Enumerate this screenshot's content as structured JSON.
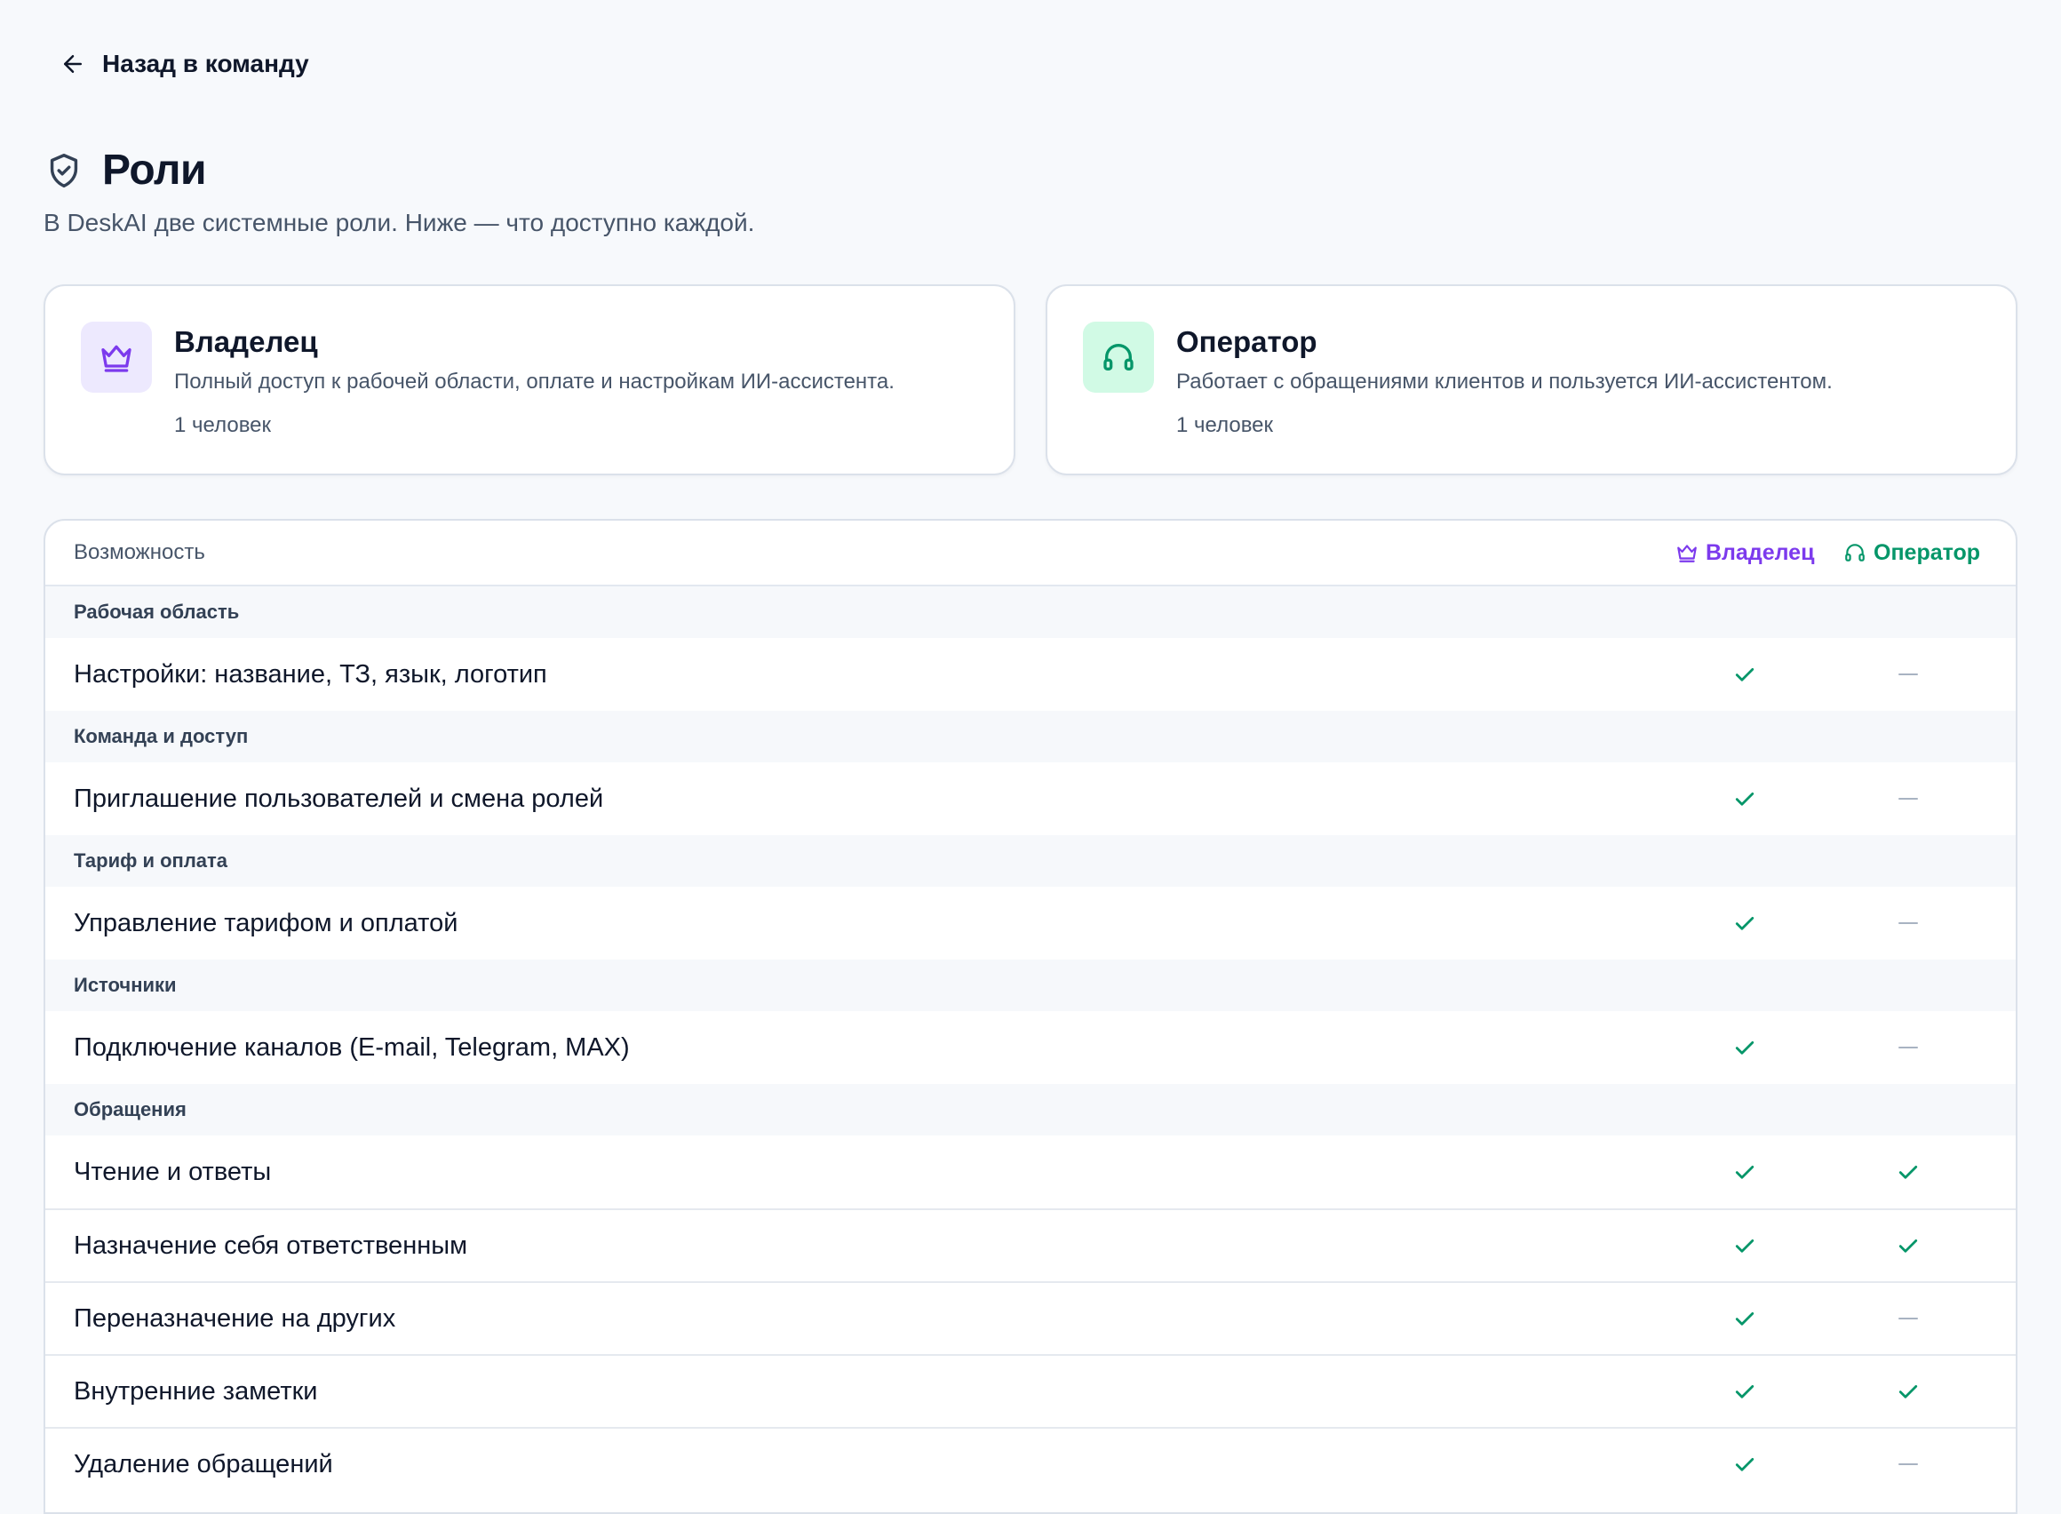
{
  "nav": {
    "back_label": "Назад в команду"
  },
  "header": {
    "title": "Роли",
    "subtitle": "В DeskAI две системные роли. Ниже — что доступно каждой."
  },
  "roles": [
    {
      "name": "Владелец",
      "description": "Полный доступ к рабочей области, оплате и настройкам ИИ-ассистента.",
      "count": "1 человек",
      "icon": "crown-icon",
      "color": "#7c3aed"
    },
    {
      "name": "Оператор",
      "description": "Работает с обращениями клиентов и пользуется ИИ-ассистентом.",
      "count": "1 человек",
      "icon": "headset-icon",
      "color": "#059669"
    }
  ],
  "table": {
    "capability_header": "Возможность",
    "owner_header": "Владелец",
    "operator_header": "Оператор",
    "sections": [
      {
        "title": "Рабочая область",
        "rows": [
          {
            "label": "Настройки: название, ТЗ, язык, логотип",
            "owner": true,
            "operator": false
          }
        ]
      },
      {
        "title": "Команда и доступ",
        "rows": [
          {
            "label": "Приглашение пользователей и смена ролей",
            "owner": true,
            "operator": false
          }
        ]
      },
      {
        "title": "Тариф и оплата",
        "rows": [
          {
            "label": "Управление тарифом и оплатой",
            "owner": true,
            "operator": false
          }
        ]
      },
      {
        "title": "Источники",
        "rows": [
          {
            "label": "Подключение каналов (E-mail, Telegram, MAX)",
            "owner": true,
            "operator": false
          }
        ]
      },
      {
        "title": "Обращения",
        "rows": [
          {
            "label": "Чтение и ответы",
            "owner": true,
            "operator": true
          },
          {
            "label": "Назначение себя ответственным",
            "owner": true,
            "operator": true
          },
          {
            "label": "Переназначение на других",
            "owner": true,
            "operator": false
          },
          {
            "label": "Внутренние заметки",
            "owner": true,
            "operator": true
          },
          {
            "label": "Удаление обращений",
            "owner": true,
            "operator": false
          }
        ]
      }
    ]
  },
  "colors": {
    "check": "#059669",
    "dash": "#a8b3c2",
    "owner_accent": "#7c3aed",
    "operator_accent": "#059669"
  }
}
